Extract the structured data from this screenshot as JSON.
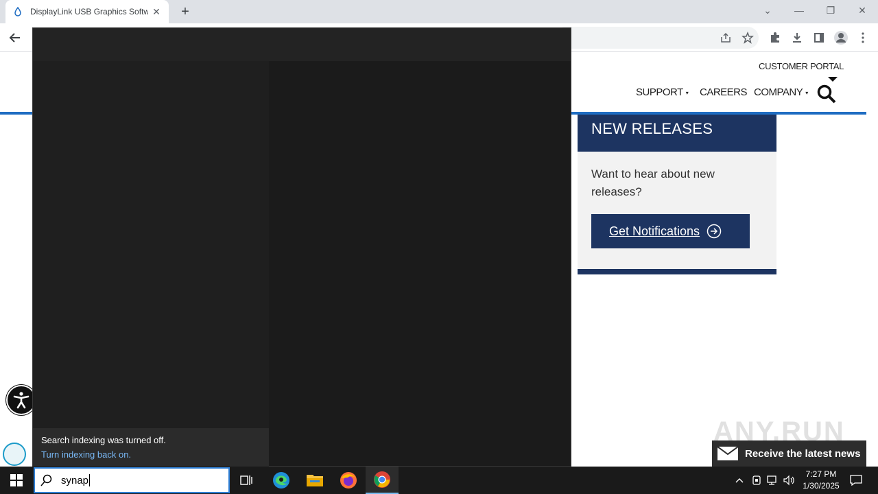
{
  "browser": {
    "tab_title": "DisplayLink USB Graphics Softwa",
    "tab_close": "✕",
    "new_tab": "+",
    "window": {
      "chevron": "⌄",
      "minimize": "—",
      "restore": "❐",
      "close": "✕"
    }
  },
  "site": {
    "nav": {
      "customer_portal": "CUSTOMER PORTAL",
      "support": "SUPPORT",
      "careers": "CAREERS",
      "company": "COMPANY",
      "dropdown_marker": "▾"
    },
    "new_releases": {
      "heading": "NEW RELEASES",
      "text": "Want to hear about new releases?",
      "button": "Get Notifications"
    },
    "news_banner": "Receive the latest news",
    "watermark": "ANY.RUN"
  },
  "search_overlay": {
    "index_notice_title": "Search indexing was turned off.",
    "index_notice_link": "Turn indexing back on."
  },
  "taskbar": {
    "search_query": "synap",
    "clock_time": "7:27 PM",
    "clock_date": "1/30/2025"
  },
  "colors": {
    "site_navy": "#1d3461",
    "site_blue_rule": "#1f6dc2",
    "taskbar_bg": "#1a1a1a",
    "overlay_bg": "#1f1f1f"
  }
}
